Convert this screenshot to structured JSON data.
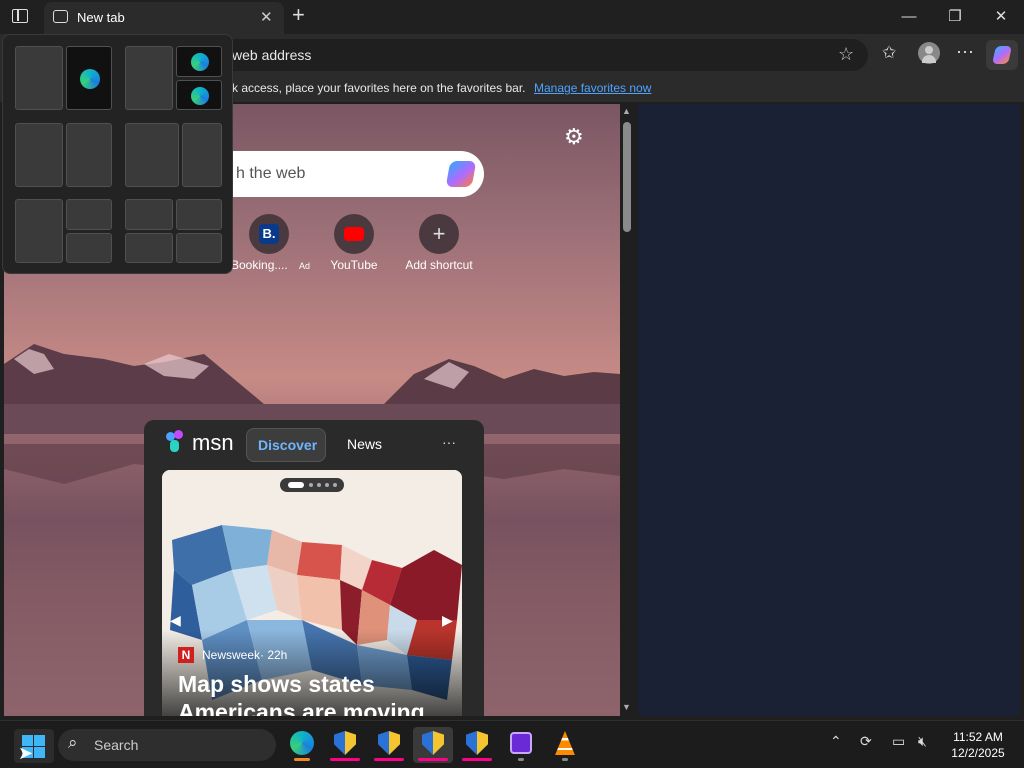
{
  "browser": {
    "tab": {
      "title": "New tab"
    },
    "address": {
      "placeholder": "web address"
    },
    "favorites_bar": {
      "hint": "k access, place your favorites here on the favorites bar.",
      "manage_link": "Manage favorites now"
    }
  },
  "new_tab_page": {
    "search": {
      "placeholder": "h the web"
    },
    "shortcuts": [
      {
        "label": "Booking....",
        "ad_label": "Ad",
        "icon": "booking-icon"
      },
      {
        "label": "YouTube",
        "icon": "youtube-icon"
      },
      {
        "label": "Add shortcut",
        "icon": "plus-icon"
      }
    ],
    "msn": {
      "brand": "msn",
      "tabs": [
        "Discover",
        "News"
      ],
      "more": "···",
      "card": {
        "source": "Newsweek",
        "age": "· 22h",
        "headline_line1": "Map shows states",
        "headline_line2": "Americans are moving"
      }
    }
  },
  "taskbar": {
    "search_placeholder": "Search",
    "time": "11:52 AM",
    "date": "12/2/2025"
  },
  "colors": {
    "accent_link": "#4fa3ff",
    "taskbar_indicator": "#ff4d8d",
    "right_pane": "#1b2134"
  }
}
